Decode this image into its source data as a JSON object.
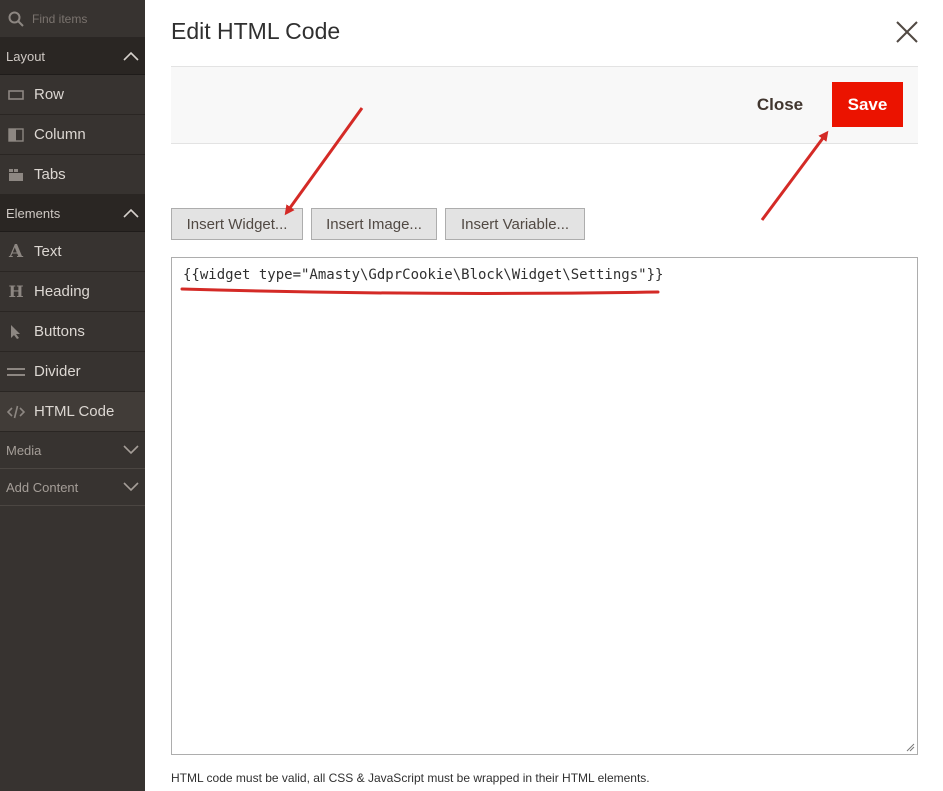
{
  "sidebar": {
    "search_placeholder": "Find items",
    "sections": [
      {
        "label": "Layout",
        "items": [
          "Row",
          "Column",
          "Tabs"
        ]
      },
      {
        "label": "Elements",
        "items": [
          "Text",
          "Heading",
          "Buttons",
          "Divider",
          "HTML Code"
        ]
      },
      {
        "label": "Media"
      },
      {
        "label": "Add Content"
      }
    ]
  },
  "modal": {
    "title": "Edit HTML Code",
    "close_label": "Close",
    "save_label": "Save",
    "toolbar": {
      "insert_widget": "Insert Widget...",
      "insert_image": "Insert Image...",
      "insert_variable": "Insert Variable..."
    },
    "code": "{{widget type=\"Amasty\\GdprCookie\\Block\\Widget\\Settings\"}}",
    "note": "HTML code must be valid, all CSS & JavaScript must be wrapped in their HTML elements."
  },
  "colors": {
    "save_bg": "#eb1300",
    "sidebar_bg": "#373330",
    "annotation_red": "#d42a26"
  }
}
